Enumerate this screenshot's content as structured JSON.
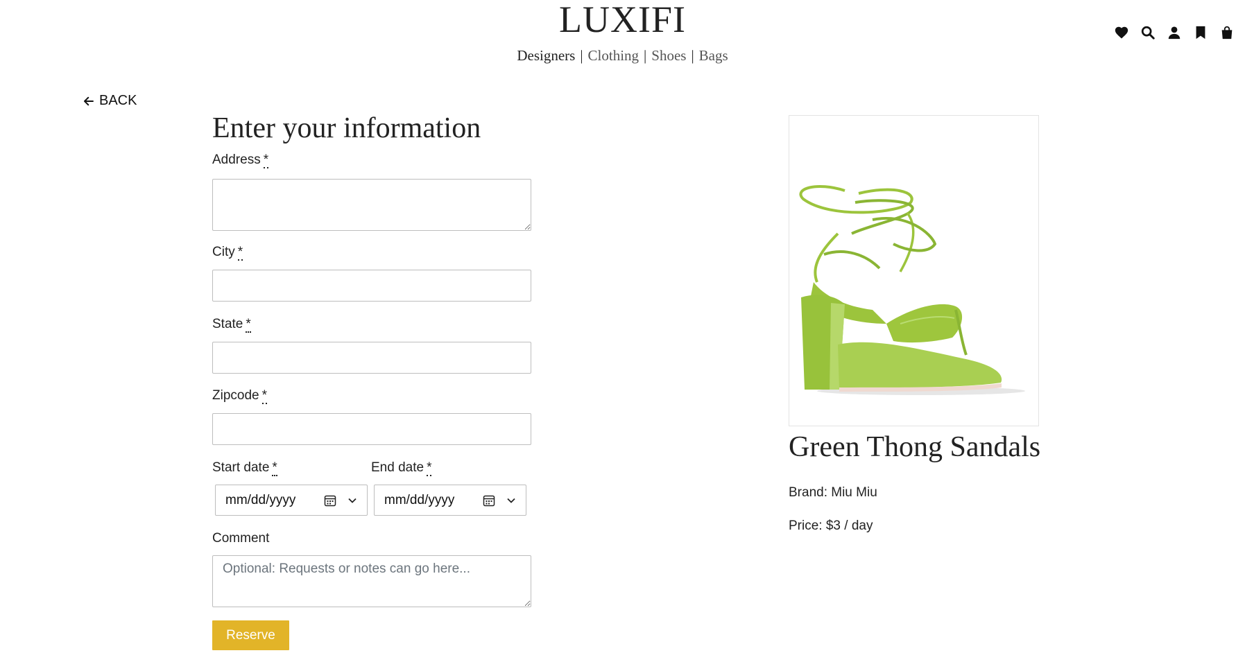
{
  "header": {
    "brand": "LUXIFI",
    "nav": [
      "Designers",
      "Clothing",
      "Shoes",
      "Bags"
    ],
    "icons": [
      "heart-icon",
      "search-icon",
      "user-icon",
      "bookmark-icon",
      "shopping-bag-icon"
    ]
  },
  "back": {
    "label": "BACK"
  },
  "form": {
    "title": "Enter your information",
    "required_mark": "*",
    "fields": {
      "address": {
        "label": "Address",
        "value": ""
      },
      "city": {
        "label": "City",
        "value": ""
      },
      "state": {
        "label": "State",
        "value": ""
      },
      "zipcode": {
        "label": "Zipcode",
        "value": ""
      },
      "start_date": {
        "label": "Start date",
        "value": "mm/dd/yyyy"
      },
      "end_date": {
        "label": "End date",
        "value": "mm/dd/yyyy"
      },
      "comment": {
        "label": "Comment",
        "value": "",
        "placeholder": "Optional: Requests or notes can go here..."
      }
    },
    "submit_label": "Reserve"
  },
  "product": {
    "title": "Green Thong Sandals",
    "brand_line": "Brand: Miu Miu",
    "price_line": "Price: $3 / day",
    "image_color": "#9cc43c"
  },
  "colors": {
    "accent": "#e2b428"
  }
}
